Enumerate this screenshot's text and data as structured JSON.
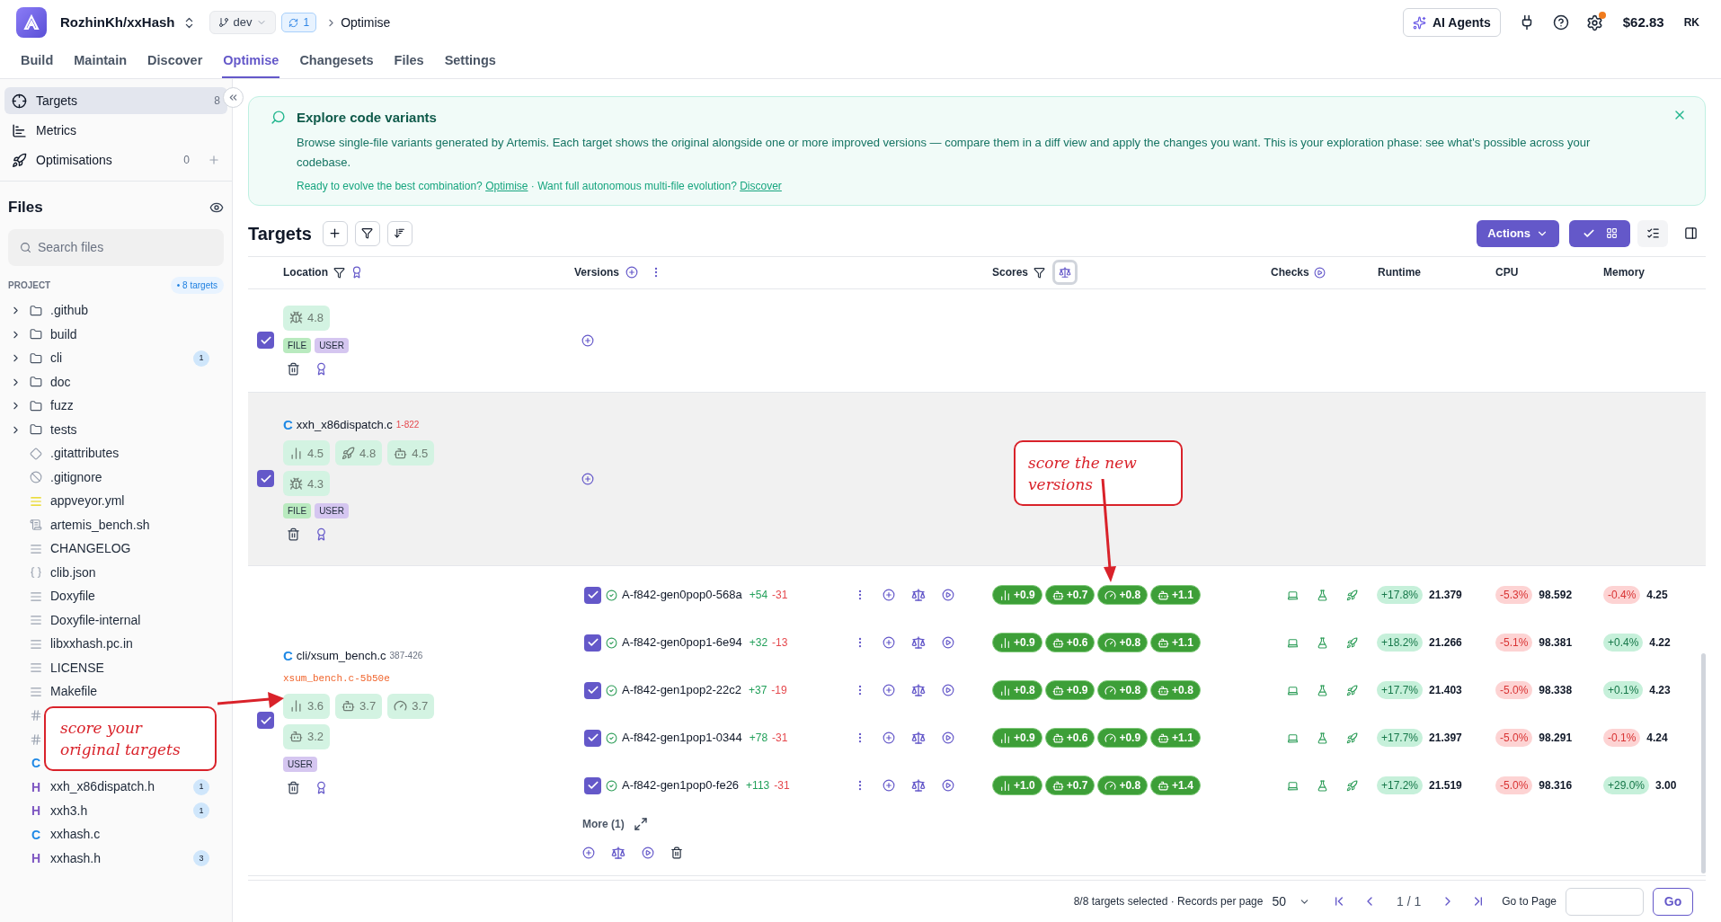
{
  "app": {
    "repo": "RozhinKh/xxHash",
    "branch": "dev",
    "sync_count": "1",
    "breadcrumb": "Optimise"
  },
  "header_right": {
    "agents_button": "AI Agents",
    "settings_notification": true,
    "balance": "$62.83",
    "user_initials": "RK"
  },
  "tabs": [
    {
      "label": "Build",
      "selected": false
    },
    {
      "label": "Maintain",
      "selected": false
    },
    {
      "label": "Discover",
      "selected": false
    },
    {
      "label": "Optimise",
      "selected": true
    },
    {
      "label": "Changesets",
      "selected": false
    },
    {
      "label": "Files",
      "selected": false
    },
    {
      "label": "Settings",
      "selected": false
    }
  ],
  "nav": [
    {
      "label": "Targets",
      "kind": "crosshair",
      "count": "8",
      "selected": true
    },
    {
      "label": "Metrics",
      "kind": "chart",
      "selected": false
    },
    {
      "label": "Optimisations",
      "kind": "rocket",
      "count": "0",
      "addable": true,
      "selected": false
    }
  ],
  "files": {
    "title": "Files",
    "search_placeholder": "Search files",
    "section": "PROJECT",
    "targets_badge": "• 8 targets",
    "tree": [
      {
        "kind": "folder",
        "name": ".github",
        "expanded": false
      },
      {
        "kind": "folder",
        "name": "build",
        "expanded": false
      },
      {
        "kind": "folder",
        "name": "cli",
        "expanded": false,
        "badge": "1"
      },
      {
        "kind": "folder",
        "name": "doc",
        "expanded": false
      },
      {
        "kind": "folder",
        "name": "fuzz",
        "expanded": false
      },
      {
        "kind": "folder",
        "name": "tests",
        "expanded": false
      },
      {
        "kind": "git",
        "name": ".gitattributes"
      },
      {
        "kind": "ignore",
        "name": ".gitignore"
      },
      {
        "kind": "yaml",
        "name": "appveyor.yml"
      },
      {
        "kind": "script",
        "name": "artemis_bench.sh"
      },
      {
        "kind": "text",
        "name": "CHANGELOG"
      },
      {
        "kind": "json",
        "name": "clib.json"
      },
      {
        "kind": "text",
        "name": "Doxyfile"
      },
      {
        "kind": "text",
        "name": "Doxyfile-internal"
      },
      {
        "kind": "text",
        "name": "libxxhash.pc.in"
      },
      {
        "kind": "text",
        "name": "LICENSE"
      },
      {
        "kind": "text",
        "name": "Makefile"
      },
      {
        "kind": "md"
      },
      {
        "kind": "md"
      },
      {
        "kind": "c",
        "icon_text": "C"
      },
      {
        "kind": "h",
        "icon_text": "H",
        "name": "xxh_x86dispatch.h",
        "badge": "1"
      },
      {
        "kind": "h",
        "icon_text": "H",
        "name": "xxh3.h",
        "badge": "1"
      },
      {
        "kind": "c",
        "icon_text": "C",
        "name": "xxhash.c"
      },
      {
        "kind": "h",
        "icon_text": "H",
        "name": "xxhash.h",
        "badge": "3"
      }
    ]
  },
  "banner": {
    "title": "Explore code variants",
    "body": "Browse single-file variants generated by Artemis. Each target shows the original alongside one or more improved versions — compare them in a diff view and apply the changes you want. This is your exploration phase: see what's possible across your codebase.",
    "cta_1": "Ready to evolve the best combination?",
    "link_1": "Optimise",
    "cta_2": "· Want full autonomous multi-file evolution?",
    "link_2": "Discover"
  },
  "targets": {
    "title": "Targets",
    "actions_button": "Actions",
    "columns": [
      "Location",
      "Versions",
      "Scores",
      "Checks",
      "Runtime",
      "CPU",
      "Memory"
    ],
    "rows": [
      {
        "checked": true,
        "shaded": false,
        "scores": [
          {
            "kind": "bug",
            "value": "4.8"
          }
        ],
        "tags": [
          {
            "label": "FILE",
            "kind": "file"
          },
          {
            "label": "USER",
            "kind": "user"
          }
        ]
      },
      {
        "checked": true,
        "shaded": true,
        "icon_text": "C",
        "file": "xxh_x86dispatch.c",
        "lines": "1-822",
        "lines_highlighted": true,
        "scores": [
          {
            "kind": "bars",
            "value": "4.5"
          },
          {
            "kind": "rocket",
            "value": "4.8"
          },
          {
            "kind": "bot",
            "value": "4.5"
          },
          {
            "kind": "bug",
            "value": "4.3"
          }
        ],
        "tags": [
          {
            "label": "FILE",
            "kind": "file"
          },
          {
            "label": "USER",
            "kind": "user"
          }
        ]
      },
      {
        "checked": true,
        "shaded": false,
        "icon_text": "C",
        "file": "cli/xsum_bench.c",
        "lines": "387-426",
        "lines_highlighted": false,
        "variant": "xsum_bench.c-5b50e",
        "scores": [
          {
            "kind": "bars",
            "value": "3.6"
          },
          {
            "kind": "bot",
            "value": "3.7"
          },
          {
            "kind": "gauge",
            "value": "3.7"
          },
          {
            "kind": "bot",
            "value": "3.2"
          }
        ],
        "tags": [
          {
            "label": "USER",
            "kind": "user"
          }
        ],
        "more": "More (1)",
        "versions": [
          {
            "checked": true,
            "name": "A-f842-gen0pop0-568a",
            "added": "+54",
            "removed": "-31",
            "scores": [
              {
                "kind": "bars",
                "value": "+0.9"
              },
              {
                "kind": "bot",
                "value": "+0.7"
              },
              {
                "kind": "gauge",
                "value": "+0.8"
              },
              {
                "kind": "bot",
                "value": "+1.1"
              }
            ],
            "runtime": {
              "change": "+17.8%",
              "improved": true,
              "value": "21.379"
            },
            "cpu": {
              "change": "-5.3%",
              "improved": false,
              "value": "98.592"
            },
            "memory": {
              "change": "-0.4%",
              "improved": false,
              "value": "4.25"
            }
          },
          {
            "checked": true,
            "name": "A-f842-gen0pop1-6e94",
            "added": "+32",
            "removed": "-13",
            "scores": [
              {
                "kind": "bars",
                "value": "+0.9"
              },
              {
                "kind": "bot",
                "value": "+0.6"
              },
              {
                "kind": "gauge",
                "value": "+0.8"
              },
              {
                "kind": "bot",
                "value": "+1.1"
              }
            ],
            "runtime": {
              "change": "+18.2%",
              "improved": true,
              "value": "21.266"
            },
            "cpu": {
              "change": "-5.1%",
              "improved": false,
              "value": "98.381"
            },
            "memory": {
              "change": "+0.4%",
              "improved": true,
              "value": "4.22"
            }
          },
          {
            "checked": true,
            "name": "A-f842-gen1pop2-22c2",
            "added": "+37",
            "removed": "-19",
            "scores": [
              {
                "kind": "bars",
                "value": "+0.8"
              },
              {
                "kind": "bot",
                "value": "+0.9"
              },
              {
                "kind": "gauge",
                "value": "+0.8"
              },
              {
                "kind": "bot",
                "value": "+0.8"
              }
            ],
            "runtime": {
              "change": "+17.7%",
              "improved": true,
              "value": "21.403"
            },
            "cpu": {
              "change": "-5.0%",
              "improved": false,
              "value": "98.338"
            },
            "memory": {
              "change": "+0.1%",
              "improved": true,
              "value": "4.23"
            }
          },
          {
            "checked": true,
            "name": "A-f842-gen1pop1-0344",
            "added": "+78",
            "removed": "-31",
            "scores": [
              {
                "kind": "bars",
                "value": "+0.9"
              },
              {
                "kind": "bot",
                "value": "+0.6"
              },
              {
                "kind": "gauge",
                "value": "+0.9"
              },
              {
                "kind": "bot",
                "value": "+1.1"
              }
            ],
            "runtime": {
              "change": "+17.7%",
              "improved": true,
              "value": "21.397"
            },
            "cpu": {
              "change": "-5.0%",
              "improved": false,
              "value": "98.291"
            },
            "memory": {
              "change": "-0.1%",
              "improved": false,
              "value": "4.24"
            }
          },
          {
            "checked": true,
            "name": "A-f842-gen1pop0-fe26",
            "added": "+113",
            "removed": "-31",
            "scores": [
              {
                "kind": "bars",
                "value": "+1.0"
              },
              {
                "kind": "bot",
                "value": "+0.7"
              },
              {
                "kind": "gauge",
                "value": "+0.8"
              },
              {
                "kind": "bot",
                "value": "+1.4"
              }
            ],
            "runtime": {
              "change": "+17.2%",
              "improved": true,
              "value": "21.519"
            },
            "cpu": {
              "change": "-5.0%",
              "improved": false,
              "value": "98.316"
            },
            "memory": {
              "change": "+29.0%",
              "improved": true,
              "value": "3.00"
            }
          }
        ]
      }
    ],
    "pagination": {
      "summary": "8/8 targets selected · Records per page",
      "per_page": "50",
      "page": "1 / 1",
      "goto_label": "Go to Page",
      "go_button": "Go"
    }
  },
  "annotations": [
    {
      "text": "score your original targets"
    },
    {
      "text": "score the new versions"
    }
  ]
}
